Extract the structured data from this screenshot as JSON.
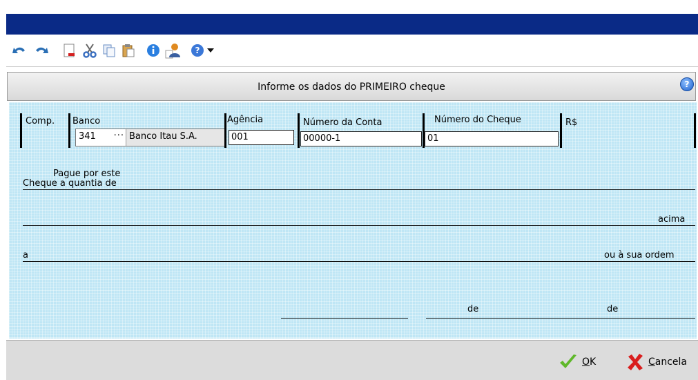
{
  "toolbar": {
    "buttons": [
      {
        "name": "undo-icon",
        "color": "#2a6fb5"
      },
      {
        "name": "redo-icon",
        "color": "#2a6fb5"
      },
      {
        "name": "new-document-icon",
        "color": "#d32020"
      },
      {
        "name": "cut-icon",
        "color": "#3a6fc0"
      },
      {
        "name": "copy-icon",
        "color": "#6a8fc5"
      },
      {
        "name": "paste-icon",
        "color": "#b08030"
      },
      {
        "name": "info-icon",
        "color": "#2a7fe0"
      },
      {
        "name": "user-icon",
        "color": "#e08a20"
      },
      {
        "name": "help-icon",
        "color": "#3b78d8"
      }
    ]
  },
  "header": {
    "title": "Informe os dados do PRIMEIRO cheque",
    "help_glyph": "?"
  },
  "check": {
    "labels": {
      "comp": "Comp.",
      "banco": "Banco",
      "agencia": "Agência",
      "conta": "Número da Conta",
      "cheque": "Número do Cheque",
      "valor": "R$"
    },
    "banco_code": "341",
    "banco_dots": "···",
    "banco_name": "Banco Itau S.A.",
    "agencia": "001",
    "conta": "00000-1",
    "cheque": "01",
    "pague_line1": "Pague por este",
    "pague_line2": "Cheque a quantia de",
    "acima": "acima",
    "a": "a",
    "ordem": "ou à sua ordem",
    "de1": "de",
    "de2": "de"
  },
  "footer": {
    "ok_label_u": "O",
    "ok_label_rest": "K",
    "cancel_label_u": "C",
    "cancel_label_rest": "ancela"
  },
  "colors": {
    "titlebar": "#0a2a86",
    "check_bg": "#bfe6f5",
    "ok": "#5fb82a",
    "cancel": "#d91e1e"
  }
}
